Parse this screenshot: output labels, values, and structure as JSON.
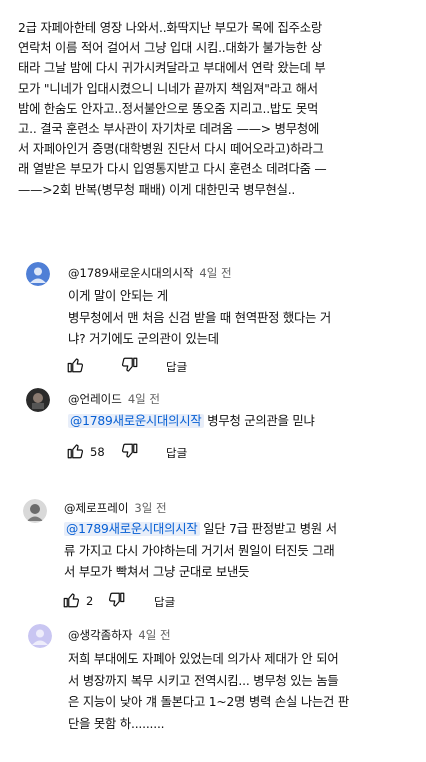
{
  "post": {
    "lines": [
      "2급 자페아한테 영장 나와서..화딱지난 부모가 목에 집주소랑",
      "연락처 이름 적어 걸어서 그냥 입대 시킴..대화가 불가능한 상",
      "태라 그날 밤에 다시 귀가시켜달라고 부대에서 연락 왔는데 부",
      "모가 \"니네가 입대시켰으니 니네가 끝까지 책임져\"라고 해서",
      "밤에 한숨도 안자고..정서불안으로 똥오줌 지리고..밥도 못먹",
      "고.. 결국 훈련소 부사관이 자기차로 데려옴 ——> 병무청에",
      "서 자페아인거 증명(대학병원 진단서 다시 떼어오라고)하라그",
      "래 열받은 부모가 다시 입영통지받고 다시 훈련소 데려다줌 —",
      "——>2회 반복(병무청 패배) 이게 대한민국 병무현실.."
    ]
  },
  "comments": [
    {
      "handle": "@1789새로운시대의시작",
      "time": "4일 전",
      "mention": "",
      "lines": [
        "이게 말이 안되는 게",
        "병무청에서 맨 처음 신검 받을 때 현역판정 했다는 거",
        "냐? 거기에도 군의관이 있는데"
      ],
      "likes": "",
      "reply_label": "답글",
      "avatar_color": "#4f7fd6"
    },
    {
      "handle": "@언레이드",
      "time": "4일 전",
      "mention": "@1789새로운시대의시작",
      "lines": [
        "병무청 군의관을 믿냐"
      ],
      "likes": "58",
      "reply_label": "답글",
      "avatar_color": "#2b2b2b"
    },
    {
      "handle": "@제로프레이",
      "time": "3일 전",
      "mention": "@1789새로운시대의시작",
      "lines": [
        "일단 7급 판정받고 병원 서",
        "류 가지고 다시 가야하는데 거기서 뭔일이 터진듯 그래",
        "서 부모가 빡쳐서 그냥 군대로 보낸듯"
      ],
      "likes": "2",
      "reply_label": "답글",
      "avatar_color": "#6b6b6b"
    },
    {
      "handle": "@생각좀하자",
      "time": "4일 전",
      "mention": "",
      "lines": [
        "저희 부대에도 자폐아 있었는데 의가사 제대가 안 되어",
        "서 병장까지 복무 시키고 전역시킴... 병무청 있는 놈들",
        "은 지능이 낮아 걔 돌본다고 1~2명 병력 손실 나는건 판",
        "단을 못함 하........."
      ],
      "likes": "",
      "reply_label": "",
      "avatar_color": "#c9c6f2"
    }
  ]
}
